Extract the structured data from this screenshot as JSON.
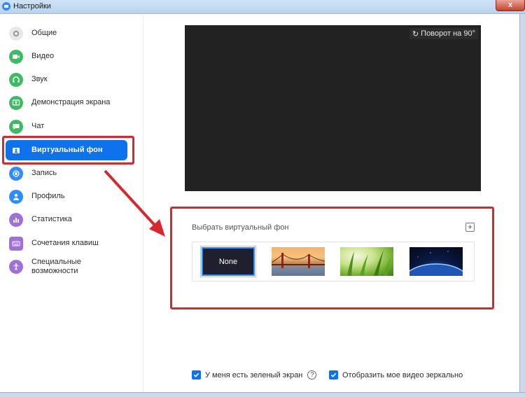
{
  "window": {
    "title": "Настройки",
    "close_label": "x"
  },
  "sidebar": {
    "items": [
      {
        "label": "Общие",
        "icon": "gear-icon",
        "color": "#d6d6d6"
      },
      {
        "label": "Видео",
        "icon": "video-icon",
        "color": "#3dbb63"
      },
      {
        "label": "Звук",
        "icon": "headphones-icon",
        "color": "#3dbb63"
      },
      {
        "label": "Демонстрация экрана",
        "icon": "share-screen-icon",
        "color": "#3dbb63"
      },
      {
        "label": "Чат",
        "icon": "chat-icon",
        "color": "#3dbb63"
      },
      {
        "label": "Виртуальный фон",
        "icon": "virtual-background-icon",
        "color": "#ffffff",
        "active": true
      },
      {
        "label": "Запись",
        "icon": "record-icon",
        "color": "#2d8cff"
      },
      {
        "label": "Профиль",
        "icon": "profile-icon",
        "color": "#2d8cff"
      },
      {
        "label": "Статистика",
        "icon": "statistics-icon",
        "color": "#a070d8"
      },
      {
        "label": "Сочетания клавиш",
        "icon": "keyboard-icon",
        "color": "#a070d8"
      },
      {
        "label": "Специальные возможности",
        "icon": "accessibility-icon",
        "color": "#a070d8"
      }
    ]
  },
  "preview": {
    "rotate_label": "Поворот на 90°"
  },
  "backgrounds": {
    "title": "Выбрать виртуальный фон",
    "add_label": "+",
    "items": [
      {
        "label": "None",
        "selected": true
      },
      {
        "label": "",
        "name": "golden-gate-bridge"
      },
      {
        "label": "",
        "name": "grass"
      },
      {
        "label": "",
        "name": "earth-from-space"
      }
    ]
  },
  "options": {
    "green_screen_label": "У меня есть зеленый экран",
    "green_screen_checked": true,
    "help_label": "?",
    "mirror_label": "Отобразить мое видео зеркально",
    "mirror_checked": true
  },
  "colors": {
    "accent": "#0e72ed",
    "highlight": "#d9272e"
  }
}
